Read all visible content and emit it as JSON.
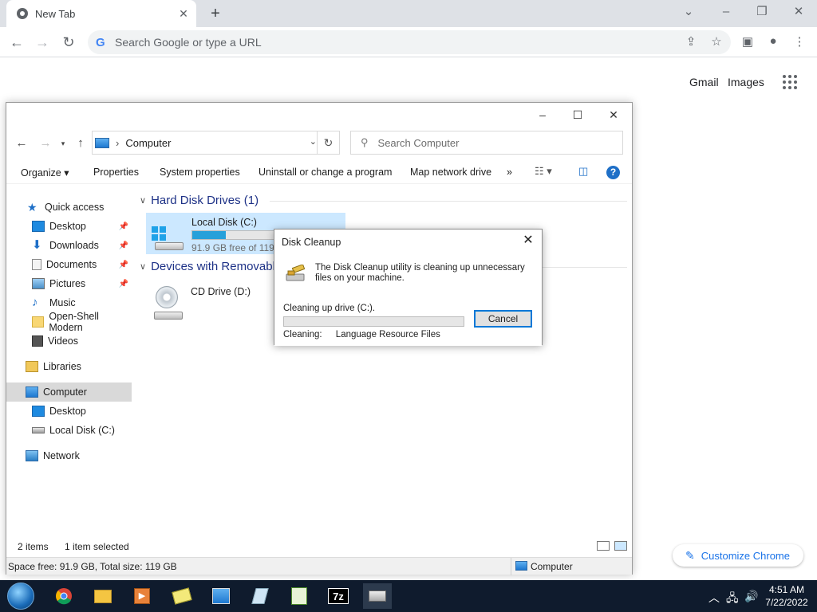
{
  "chrome": {
    "tab_title": "New Tab",
    "omnibox_placeholder": "Search Google or type a URL",
    "ntp_links": {
      "gmail": "Gmail",
      "images": "Images"
    },
    "customize_label": "Customize Chrome"
  },
  "explorer": {
    "address": "Computer",
    "search_placeholder": "Search Computer",
    "commands": {
      "organize": "Organize",
      "properties": "Properties",
      "system_properties": "System properties",
      "uninstall": "Uninstall or change a program",
      "map_drive": "Map network drive",
      "more": "»"
    },
    "nav": {
      "quick_access": "Quick access",
      "desktop": "Desktop",
      "downloads": "Downloads",
      "documents": "Documents",
      "pictures": "Pictures",
      "music": "Music",
      "openshell": "Open-Shell Modern",
      "videos": "Videos",
      "libraries": "Libraries",
      "computer": "Computer",
      "computer_desktop": "Desktop",
      "computer_local_disk": "Local Disk (C:)",
      "network": "Network"
    },
    "groups": {
      "hdd": "Hard Disk Drives (1)",
      "removable": "Devices with Removable Storage (1)"
    },
    "drives": {
      "c_name": "Local Disk (C:)",
      "c_free": "91.9 GB free of 119 GB",
      "c_used_fraction": 0.23,
      "d_name": "CD Drive (D:)"
    },
    "status": {
      "items": "2 items",
      "selected": "1 item selected",
      "space": "Space free: 91.9 GB, Total size: 119 GB",
      "location": "Computer"
    }
  },
  "dialog": {
    "title": "Disk Cleanup",
    "message": "The Disk Cleanup utility is cleaning up unnecessary files on your machine.",
    "progress_label": "Cleaning up drive  (C:).",
    "progress_fraction": 0,
    "cancel": "Cancel",
    "cleaning_label": "Cleaning:",
    "cleaning_value": "Language Resource Files"
  },
  "taskbar": {
    "time": "4:51 AM",
    "date": "7/22/2022",
    "sevenzip_label": "7z"
  },
  "colors": {
    "selection": "#cce8ff",
    "progress": "#26a0da",
    "accent": "#0078d7",
    "taskbar": "#0f1b2d"
  }
}
